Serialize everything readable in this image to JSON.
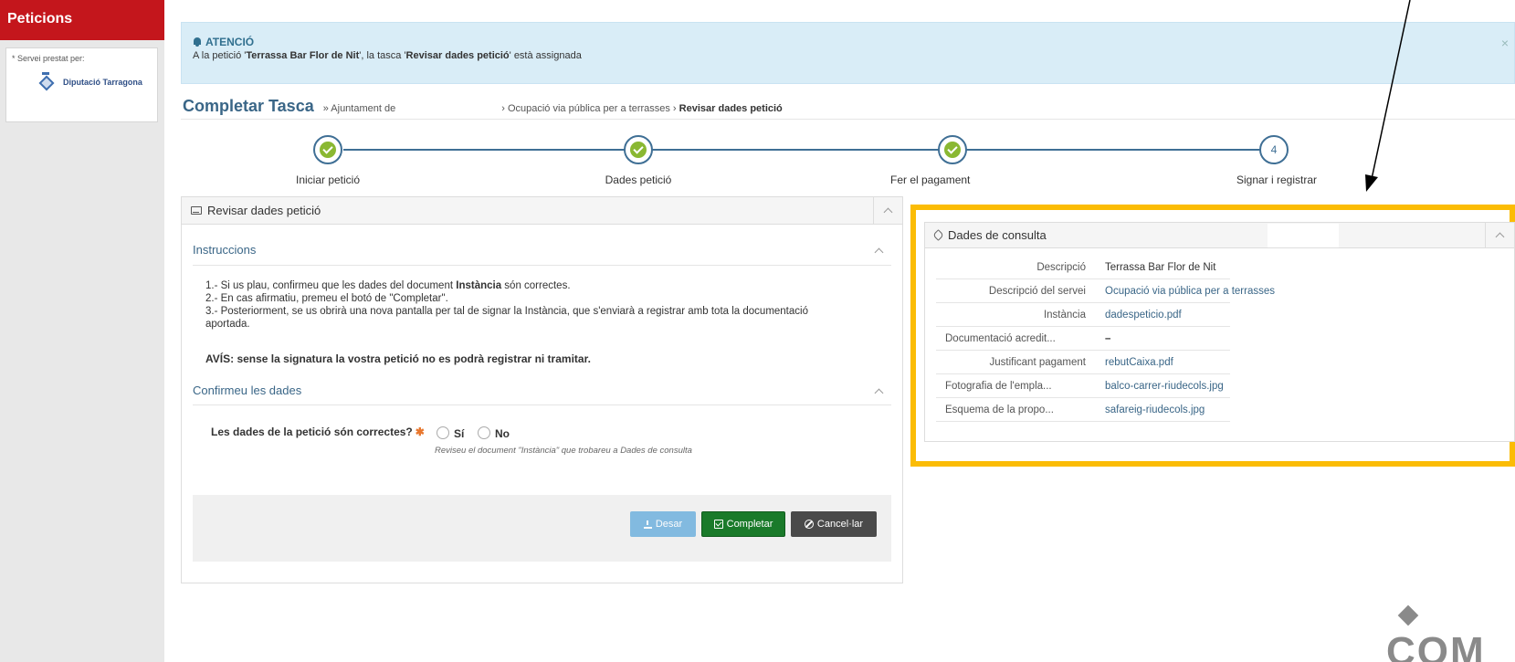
{
  "sidebar": {
    "title": "Peticions",
    "service_label": "* Servei prestat per:",
    "provider_name": "Diputació Tarragona"
  },
  "alert": {
    "heading": "ATENCIÓ",
    "message_prefix": "A la petició '",
    "message_request": "Terrassa Bar Flor de Nit",
    "message_mid": "', la tasca '",
    "message_task": "Revisar dades petició",
    "message_suffix": "' està assignada",
    "close": "×"
  },
  "header": {
    "title": "Completar Tasca",
    "crumb_prefix": "» Ajuntament de",
    "crumb_rest": "› Ocupació via pública per a terrasses ›",
    "crumb_current": "Revisar dades petició"
  },
  "steps": [
    {
      "label": "Iniciar petició",
      "state": "done"
    },
    {
      "label": "Dades petició",
      "state": "done"
    },
    {
      "label": "Fer el pagament",
      "state": "done"
    },
    {
      "label": "Signar i registrar",
      "state": "current",
      "number": "4"
    }
  ],
  "review_panel": {
    "title": "Revisar dades petició",
    "instructions_title": "Instruccions",
    "instr_1a": "1.- Si us plau, confirmeu que les dades del document ",
    "instr_1b": "Instància",
    "instr_1c": " són correctes.",
    "instr_2": "2.- En cas afirmatiu, premeu el botó de \"Completar\".",
    "instr_3": "3.- Posteriorment, se us obrirà una nova pantalla per tal de signar la Instància, que s'enviarà a registrar amb tota la documentació aportada.",
    "warning": "AVÍS: sense la signatura la vostra petició no es podrà registrar ni tramitar.",
    "confirm_title": "Confirmeu les dades",
    "question": "Les dades de la petició són correctes?",
    "required_mark": "✱",
    "option_yes": "Sí",
    "option_no": "No",
    "hint": "Reviseu el document \"Instància\" que trobareu a Dades de consulta",
    "btn_save": "Desar",
    "btn_complete": "Completar",
    "btn_cancel": "Cancel·lar"
  },
  "consult_panel": {
    "title": "Dades de consulta",
    "rows": [
      {
        "key": "Descripció",
        "value": "Terrassa Bar Flor de Nit",
        "link": false
      },
      {
        "key": "Descripció del servei",
        "value": "Ocupació via pública per a terrasses",
        "link": true
      },
      {
        "key": "Instància",
        "value": "dadespeticio.pdf",
        "link": true
      },
      {
        "key": "Documentació acredit...",
        "value": "–",
        "link": false
      },
      {
        "key": "Justificant pagament",
        "value": "rebutCaixa.pdf",
        "link": true
      },
      {
        "key": "Fotografia de l'empla...",
        "value": "balco-carrer-riudecols.jpg",
        "link": true
      },
      {
        "key": "Esquema de la propo...",
        "value": "safareig-riudecols.jpg",
        "link": true
      }
    ]
  },
  "footer_logo": "COM",
  "colors": {
    "brand_red": "#c4161c",
    "highlight": "#fbbc05",
    "complete_green": "#1a7a2a",
    "step_blue": "#3f6f95"
  }
}
